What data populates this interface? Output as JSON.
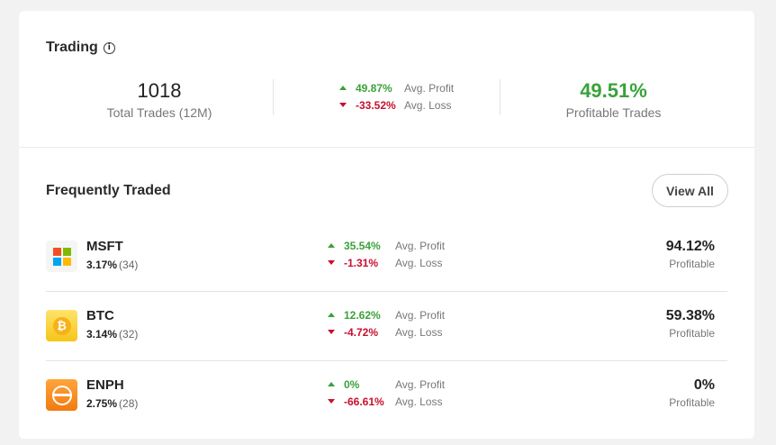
{
  "trading": {
    "title": "Trading",
    "info_icon": "info-icon",
    "total_trades": "1018",
    "total_trades_label": "Total Trades (12M)",
    "avg_profit": "49.87%",
    "avg_profit_label": "Avg. Profit",
    "avg_loss": "-33.52%",
    "avg_loss_label": "Avg. Loss",
    "profitable_pct": "49.51%",
    "profitable_label": "Profitable Trades"
  },
  "frequently_traded": {
    "title": "Frequently Traded",
    "view_all_label": "View All",
    "items": [
      {
        "ticker": "MSFT",
        "weight": "3.17%",
        "count": "(34)",
        "avg_profit": "35.54%",
        "avg_profit_label": "Avg. Profit",
        "avg_loss": "-1.31%",
        "avg_loss_label": "Avg. Loss",
        "profitable_pct": "94.12%",
        "profitable_label": "Profitable",
        "icon": "microsoft-logo-icon"
      },
      {
        "ticker": "BTC",
        "weight": "3.14%",
        "count": "(32)",
        "avg_profit": "12.62%",
        "avg_profit_label": "Avg. Profit",
        "avg_loss": "-4.72%",
        "avg_loss_label": "Avg. Loss",
        "profitable_pct": "59.38%",
        "profitable_label": "Profitable",
        "icon": "bitcoin-logo-icon"
      },
      {
        "ticker": "ENPH",
        "weight": "2.75%",
        "count": "(28)",
        "avg_profit": "0%",
        "avg_profit_label": "Avg. Profit",
        "avg_loss": "-66.61%",
        "avg_loss_label": "Avg. Loss",
        "profitable_pct": "0%",
        "profitable_label": "Profitable",
        "icon": "enphase-logo-icon"
      }
    ]
  },
  "colors": {
    "positive": "#3aa23a",
    "negative": "#c8102e",
    "microsoft": [
      "#f25022",
      "#7fba00",
      "#00a4ef",
      "#ffb900"
    ]
  }
}
